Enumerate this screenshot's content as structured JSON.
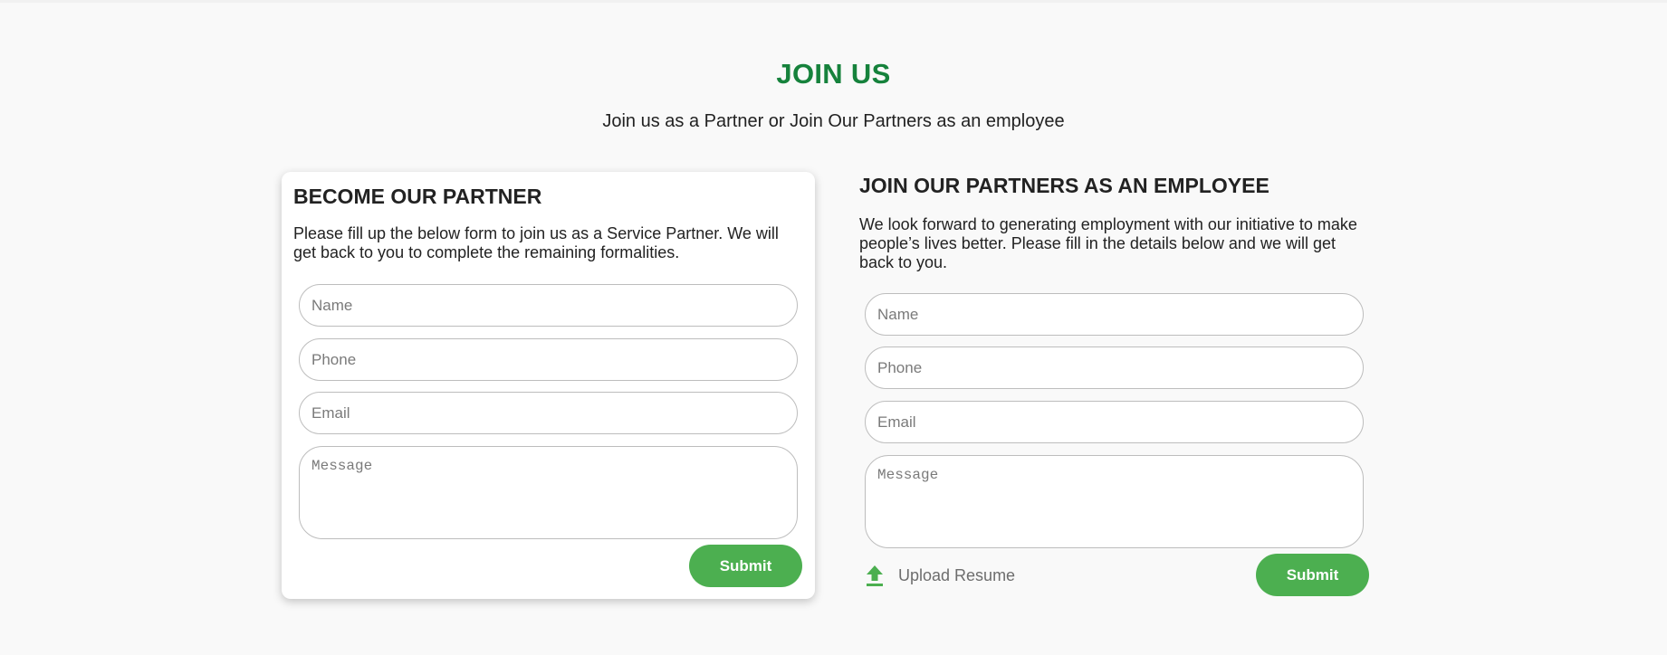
{
  "header": {
    "title": "JOIN US",
    "subtitle": "Join us as a Partner or Join Our Partners as an employee"
  },
  "partner_form": {
    "heading": "BECOME OUR PARTNER",
    "description": "Please fill up the below form to join us as a Service Partner. We will get back to you to complete the remaining formalities.",
    "name_placeholder": "Name",
    "phone_placeholder": "Phone",
    "email_placeholder": "Email",
    "message_placeholder": "Message",
    "submit_label": "Submit"
  },
  "employee_form": {
    "heading": "JOIN OUR PARTNERS AS AN EMPLOYEE",
    "description": "We look forward to generating employment with our initiative to make people’s lives better. Please fill in the details below and we will get back to you.",
    "name_placeholder": "Name",
    "phone_placeholder": "Phone",
    "email_placeholder": "Email",
    "message_placeholder": "Message",
    "upload_label": "Upload Resume",
    "upload_icon": "upload-arrow-icon",
    "submit_label": "Submit"
  },
  "colors": {
    "accent_green": "#16823c",
    "button_green": "#4caf50",
    "background": "#f9f9f9"
  }
}
